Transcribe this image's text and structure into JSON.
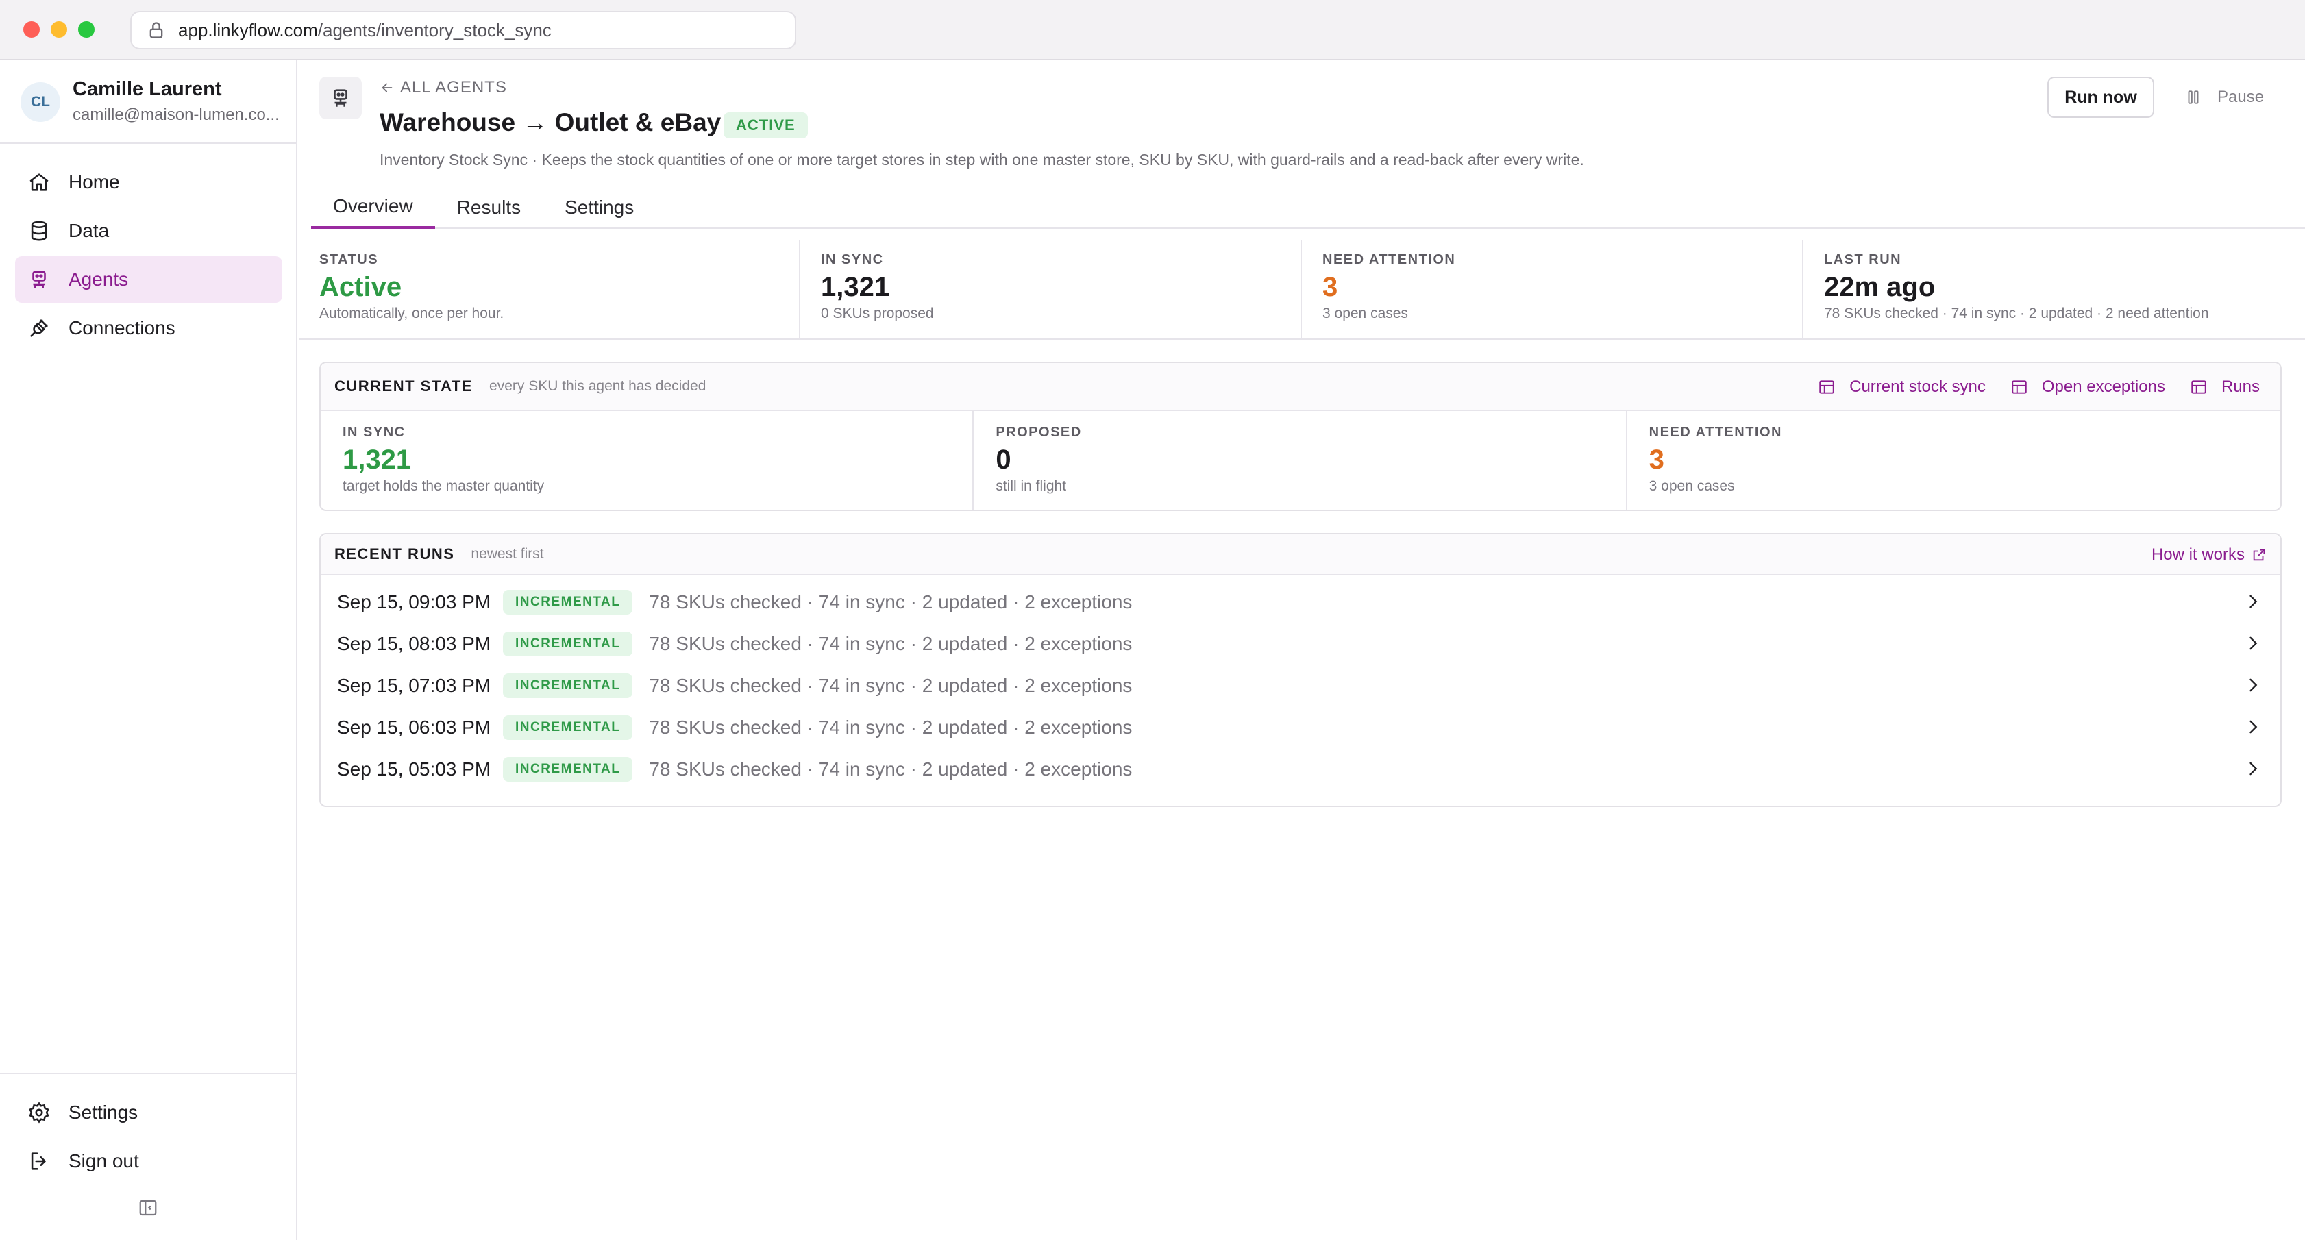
{
  "browser": {
    "url_host": "app.linkyflow.com",
    "url_path": "/agents/inventory_stock_sync"
  },
  "user": {
    "initials": "CL",
    "name": "Camille Laurent",
    "email": "camille@maison-lumen.co..."
  },
  "sidebar": {
    "items": [
      {
        "label": "Home",
        "icon": "home-icon"
      },
      {
        "label": "Data",
        "icon": "database-icon"
      },
      {
        "label": "Agents",
        "icon": "agent-icon",
        "active": true
      },
      {
        "label": "Connections",
        "icon": "plug-icon"
      }
    ],
    "bottom": [
      {
        "label": "Settings",
        "icon": "gear-icon"
      },
      {
        "label": "Sign out",
        "icon": "sign-out-icon"
      }
    ]
  },
  "header": {
    "back_label": "ALL AGENTS",
    "title": "Warehouse → Outlet & eBay",
    "status_badge": "ACTIVE",
    "description": "Inventory Stock Sync · Keeps the stock quantities of one or more target stores in step with one master store, SKU by SKU, with guard-rails and a read-back after every write.",
    "run_now_label": "Run now",
    "pause_label": "Pause"
  },
  "tabs": [
    {
      "label": "Overview",
      "active": true
    },
    {
      "label": "Results"
    },
    {
      "label": "Settings"
    }
  ],
  "stats": [
    {
      "label": "STATUS",
      "value": "Active",
      "sub": "Automatically, once per hour.",
      "color": "#2e9a45"
    },
    {
      "label": "IN SYNC",
      "value": "1,321",
      "sub": "0 SKUs proposed",
      "color": "#1c1b1f"
    },
    {
      "label": "NEED ATTENTION",
      "value": "3",
      "sub": "3 open cases",
      "color": "#e06e1f"
    },
    {
      "label": "LAST RUN",
      "value": "22m ago",
      "sub": "78 SKUs checked · 74 in sync · 2 updated · 2 need attention",
      "color": "#1c1b1f"
    }
  ],
  "current_state": {
    "title": "CURRENT STATE",
    "subtitle": "every SKU this agent has decided",
    "links": [
      "Current stock sync",
      "Open exceptions",
      "Runs"
    ],
    "columns": [
      {
        "label": "IN SYNC",
        "value": "1,321",
        "sub": "target holds the master quantity",
        "color": "#2e9a45"
      },
      {
        "label": "PROPOSED",
        "value": "0",
        "sub": "still in flight",
        "color": "#1c1b1f"
      },
      {
        "label": "NEED ATTENTION",
        "value": "3",
        "sub": "3 open cases",
        "color": "#e06e1f"
      }
    ]
  },
  "recent_runs": {
    "title": "RECENT RUNS",
    "subtitle": "newest first",
    "how_label": "How it works",
    "rows": [
      {
        "date": "Sep 15, 09:03 PM",
        "badge": "INCREMENTAL",
        "summary": "78 SKUs checked · 74 in sync · 2 updated · 2 exceptions"
      },
      {
        "date": "Sep 15, 08:03 PM",
        "badge": "INCREMENTAL",
        "summary": "78 SKUs checked · 74 in sync · 2 updated · 2 exceptions"
      },
      {
        "date": "Sep 15, 07:03 PM",
        "badge": "INCREMENTAL",
        "summary": "78 SKUs checked · 74 in sync · 2 updated · 2 exceptions"
      },
      {
        "date": "Sep 15, 06:03 PM",
        "badge": "INCREMENTAL",
        "summary": "78 SKUs checked · 74 in sync · 2 updated · 2 exceptions"
      },
      {
        "date": "Sep 15, 05:03 PM",
        "badge": "INCREMENTAL",
        "summary": "78 SKUs checked · 74 in sync · 2 updated · 2 exceptions"
      }
    ]
  },
  "colors": {
    "accent": "#8b1c8f",
    "success": "#2e9a45",
    "warning": "#e06e1f"
  }
}
